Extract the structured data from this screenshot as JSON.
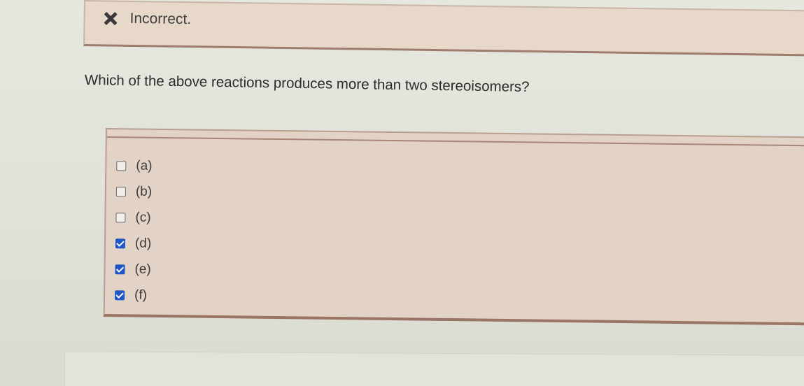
{
  "feedback": {
    "icon": "x-icon",
    "text": "Incorrect."
  },
  "question": {
    "text": "Which of the above reactions produces more than two stereoisomers?"
  },
  "options": [
    {
      "label": "(a)",
      "checked": false
    },
    {
      "label": "(b)",
      "checked": false
    },
    {
      "label": "(c)",
      "checked": false
    },
    {
      "label": "(d)",
      "checked": true
    },
    {
      "label": "(e)",
      "checked": true
    },
    {
      "label": "(f)",
      "checked": true
    }
  ],
  "colors": {
    "checkbox_checked": "#1e56c6",
    "feedback_bg": "#e7d8c9",
    "options_bg": "#e3d2c6"
  }
}
